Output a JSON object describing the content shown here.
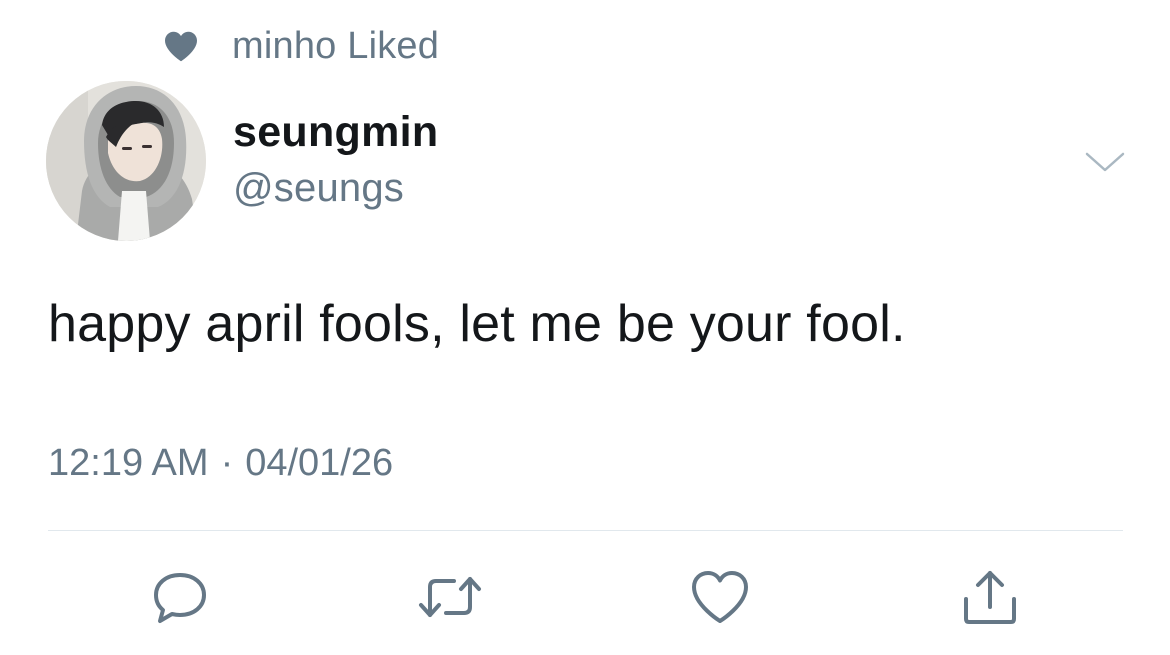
{
  "social_context": {
    "icon": "heart-filled-icon",
    "text": "minho Liked"
  },
  "author": {
    "display_name": "seungmin",
    "handle": "@seungs"
  },
  "tweet": {
    "text": "happy april fools, let me be your fool.",
    "time": "12:19 AM",
    "separator": "·",
    "date": "04/01/26"
  },
  "actions": [
    {
      "name": "reply",
      "icon": "comment-icon"
    },
    {
      "name": "retweet",
      "icon": "retweet-icon"
    },
    {
      "name": "like",
      "icon": "heart-outline-icon"
    },
    {
      "name": "share",
      "icon": "share-icon"
    }
  ],
  "colors": {
    "muted": "#657786",
    "text": "#14171a",
    "divider": "#e1e8ed",
    "icon": "#657786"
  }
}
